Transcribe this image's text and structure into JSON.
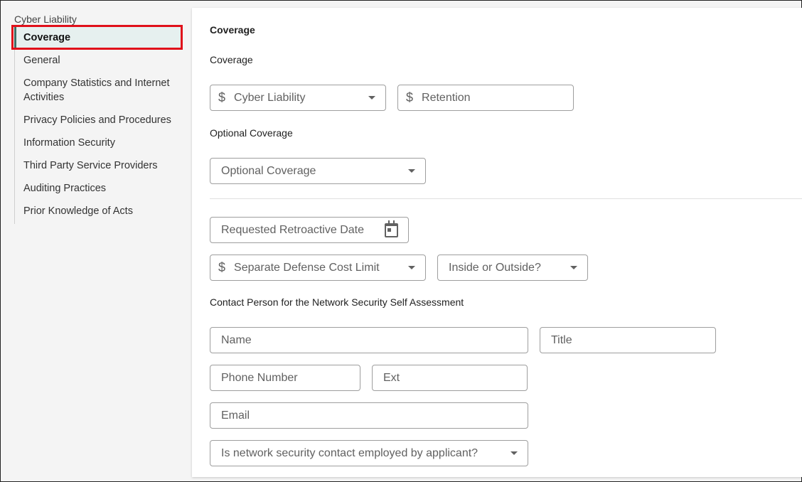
{
  "sidebar": {
    "section_title": "Cyber Liability",
    "items": [
      {
        "label": "Coverage"
      },
      {
        "label": "General"
      },
      {
        "label": "Company Statistics and Internet Activities"
      },
      {
        "label": "Privacy Policies and Procedures"
      },
      {
        "label": "Information Security"
      },
      {
        "label": "Third Party Service Providers"
      },
      {
        "label": "Auditing Practices"
      },
      {
        "label": "Prior Knowledge of Acts"
      }
    ]
  },
  "main": {
    "title": "Coverage",
    "coverage_label": "Coverage",
    "cyber_liability_select": "Cyber Liability",
    "retention_field": "Retention",
    "optional_coverage_label": "Optional Coverage",
    "optional_coverage_select": "Optional Coverage",
    "retro_date_field": "Requested Retroactive Date",
    "defense_cost_select": "Separate Defense Cost Limit",
    "inside_outside_select": "Inside or Outside?",
    "contact_label": "Contact Person for the Network Security Self Assessment",
    "name_field": "Name",
    "title_field": "Title",
    "phone_field": "Phone Number",
    "ext_field": "Ext",
    "email_field": "Email",
    "employed_select": "Is network security contact employed by applicant?"
  },
  "colors": {
    "active_accent": "#3d7068",
    "active_bg": "#e6f0ef",
    "highlight_box": "#e0101a"
  },
  "icons": {
    "currency": "dollar-icon",
    "dropdown": "chevron-down-icon",
    "calendar": "calendar-icon"
  }
}
